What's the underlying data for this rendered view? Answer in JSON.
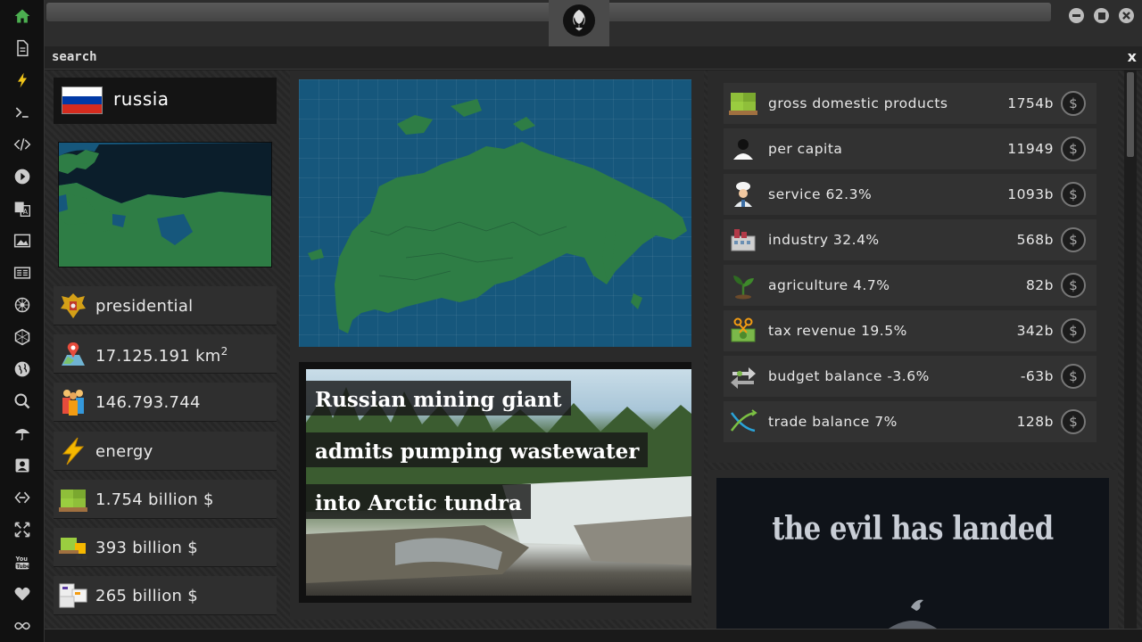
{
  "sidebar": {
    "items": [
      {
        "icon": "home-icon",
        "color": "#4caf50"
      },
      {
        "icon": "document-icon"
      },
      {
        "icon": "lightning-icon"
      },
      {
        "icon": "terminal-icon"
      },
      {
        "icon": "code-icon"
      },
      {
        "icon": "play-icon"
      },
      {
        "icon": "translate-icon"
      },
      {
        "icon": "image-icon"
      },
      {
        "icon": "news-icon"
      },
      {
        "icon": "settings-wheel-icon"
      },
      {
        "icon": "hexagon-icon"
      },
      {
        "icon": "globe-icon"
      },
      {
        "icon": "search-icon"
      },
      {
        "icon": "umbrella-icon"
      },
      {
        "icon": "contact-icon"
      },
      {
        "icon": "link-icon"
      },
      {
        "icon": "expand-icon"
      },
      {
        "icon": "youtube-icon"
      },
      {
        "icon": "heart-icon"
      },
      {
        "icon": "infinity-icon"
      }
    ]
  },
  "search": {
    "label": "search",
    "close": "x"
  },
  "country": {
    "name": "russia",
    "flag_colors": [
      "#ffffff",
      "#0039a6",
      "#d52b1e"
    ]
  },
  "stats": {
    "government": "presidential",
    "area": "17.125.191 km",
    "area_unit_sup": "2",
    "population": "146.793.744",
    "resource": "energy",
    "gdp": "1.754 billion $",
    "industry": "393 billion $",
    "exports": "265 billion $"
  },
  "news": {
    "lines": [
      "Russian mining giant",
      "admits pumping wastewater",
      "into Arctic tundra"
    ]
  },
  "economy": [
    {
      "label": "gross domestic products",
      "value": "1754b",
      "icon": "money-pallet-icon"
    },
    {
      "label": "per capita",
      "value": "11949",
      "icon": "person-icon"
    },
    {
      "label": "service 62.3%",
      "value": "1093b",
      "icon": "chef-icon"
    },
    {
      "label": "industry 32.4%",
      "value": "568b",
      "icon": "factory-icon"
    },
    {
      "label": "agriculture 4.7%",
      "value": "82b",
      "icon": "sprout-icon"
    },
    {
      "label": "tax revenue 19.5%",
      "value": "342b",
      "icon": "tax-scissors-icon"
    },
    {
      "label": "budget balance -3.6%",
      "value": "-63b",
      "icon": "balance-arrows-icon"
    },
    {
      "label": "trade balance 7%",
      "value": "128b",
      "icon": "trade-cross-icon"
    }
  ],
  "dollar_symbol": "$",
  "promo": {
    "title": "the evil has landed"
  },
  "colors": {
    "land": "#2e7d45",
    "sea": "#16577c",
    "accent_green": "#4caf50"
  }
}
